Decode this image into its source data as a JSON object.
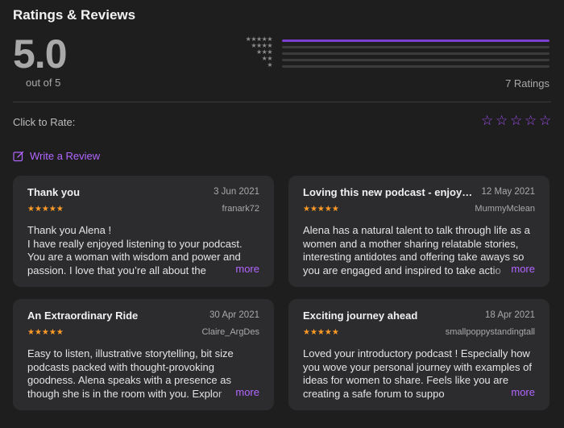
{
  "header": {
    "title": "Ratings & Reviews"
  },
  "summary": {
    "average": "5.0",
    "out_of": "out of 5",
    "total": "7 Ratings",
    "histogram": [
      {
        "stars": 5,
        "fraction": 1.0
      },
      {
        "stars": 4,
        "fraction": 0.0
      },
      {
        "stars": 3,
        "fraction": 0.0
      },
      {
        "stars": 2,
        "fraction": 0.0
      },
      {
        "stars": 1,
        "fraction": 0.0
      }
    ],
    "bar_fill_color": "#7d3fd1"
  },
  "rate": {
    "label": "Click to Rate:",
    "star_icon": "star-outline-icon",
    "count": 5
  },
  "write_review": {
    "label": "Write a Review",
    "icon": "compose-icon"
  },
  "reviews": [
    {
      "title": "Thank you",
      "date": "3 Jun 2021",
      "stars": "★★★★★",
      "author": "franark72",
      "body": "Thank you Alena !\nI have really enjoyed listening to your podcast. You are a woman with wisdom and power and passion. I love that you’re all about the",
      "more": "more"
    },
    {
      "title": "Loving this new podcast - enjoya...",
      "date": "12 May 2021",
      "stars": "★★★★★",
      "author": "MummyMclean",
      "body": "Alena has a natural talent to talk through life as a women and a mother sharing relatable stories, interesting antidotes and offering take aways so you are engaged and inspired to take actio",
      "more": "more"
    },
    {
      "title": "An Extraordinary Ride",
      "date": "30 Apr 2021",
      "stars": "★★★★★",
      "author": "Claire_ArgDes",
      "body": "Easy to listen, illustrative storytelling, bit size podcasts packed with thought-provoking goodness. Alena speaks with a presence as though she is in the room with you. Explor",
      "more": "more"
    },
    {
      "title": "Exciting journey ahead",
      "date": "18 Apr 2021",
      "stars": "★★★★★",
      "author": "smallpoppystandingtall",
      "body": "Loved your introductory podcast ! Especially how you wove your personal journey with examples of ideas for women to share. Feels like you are creating a safe forum to suppo",
      "more": "more"
    }
  ]
}
